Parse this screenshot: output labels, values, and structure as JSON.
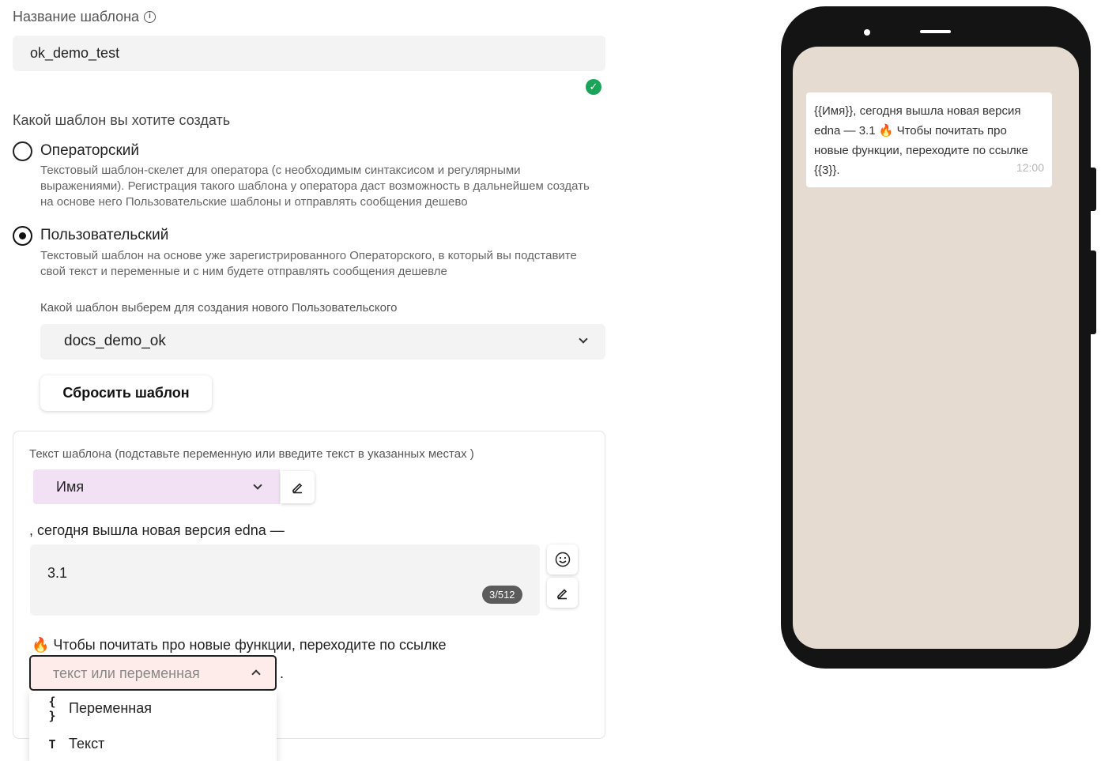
{
  "template_name": {
    "label": "Название шаблона",
    "info_icon": "i",
    "value": "ok_demo_test",
    "valid_icon": "✓"
  },
  "template_type": {
    "question": "Какой шаблон вы хотите создать",
    "options": [
      {
        "title": "Операторский",
        "selected": false,
        "description": "Текстовый шаблон-скелет для оператора (с необходимым синтаксисом и регулярными выражениями). Регистрация такого шаблона у оператора даст возможность в дальнейшем создать на основе него Пользовательские шаблоны и отправлять сообщения дешево"
      },
      {
        "title": "Пользовательский",
        "selected": true,
        "description": "Текстовый шаблон на основе уже зарегистрированного Операторского, в который вы подставите свой текст и переменные и с ним будете отправлять сообщения дешевле"
      }
    ]
  },
  "base_template": {
    "label": "Какой шаблон выберем для создания нового Пользовательского",
    "selected": "docs_demo_ok",
    "reset_label": "Сбросить шаблон"
  },
  "template_text": {
    "label": "Текст шаблона (подставьте переменную или введите текст в указанных местах )",
    "variable_1": "Имя",
    "static_1": ", сегодня вышла новая версия edna —",
    "input_value": "3.1",
    "counter": "3/512",
    "static_2": "🔥 Чтобы почитать про новые функции, переходите по ссылке",
    "slot_placeholder": "текст или переменная",
    "slot_suffix": ".",
    "menu": [
      {
        "icon": "{ }",
        "label": "Переменная"
      },
      {
        "icon": "T",
        "label": "Текст"
      }
    ]
  },
  "preview": {
    "message": "{{Имя}}, сегодня вышла новая версия edna — 3.1 🔥  Чтобы почитать про новые функции, переходите по ссылке {{3}}.",
    "time": "12:00"
  },
  "colors": {
    "success": "#1aa45a",
    "variable_bg": "#f2e1f5",
    "phone_frame": "#141414",
    "phone_screen": "#e6dbd1",
    "error_bg": "#fdecea"
  }
}
